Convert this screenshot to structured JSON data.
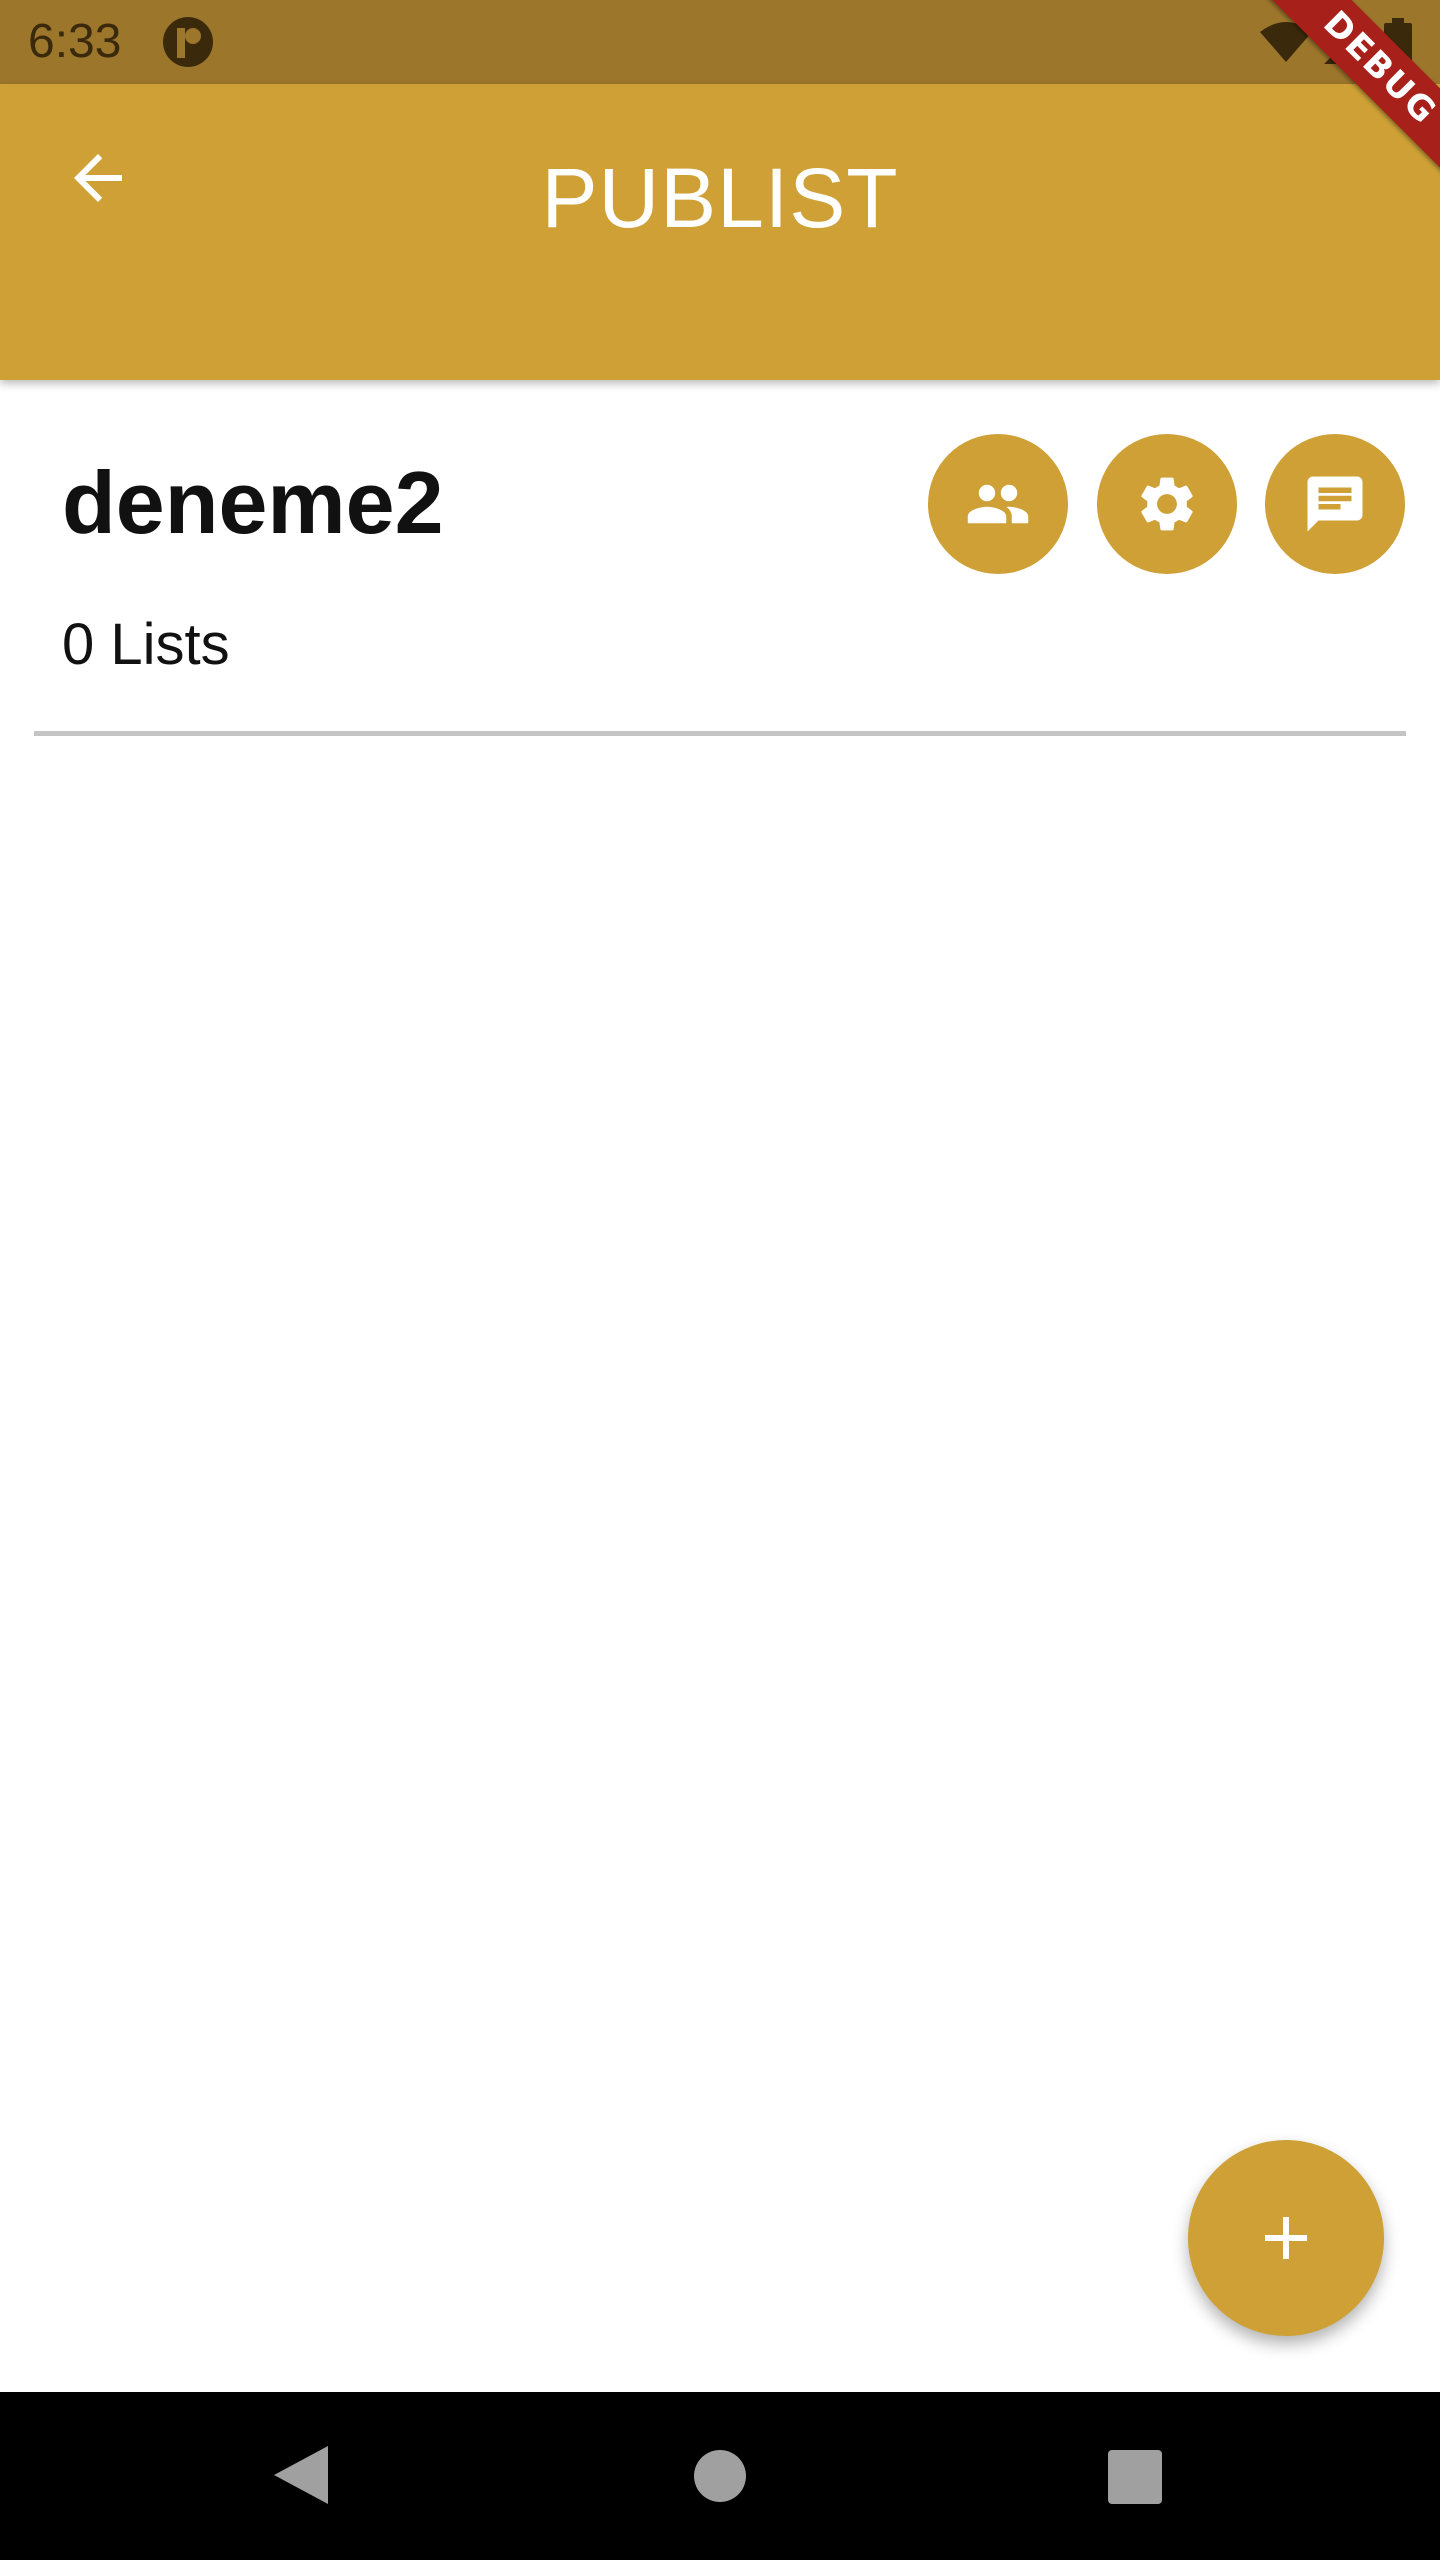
{
  "status_bar": {
    "time": "6:33",
    "icons": [
      "app-notification-icon",
      "wifi-icon",
      "signal-icon",
      "battery-icon"
    ]
  },
  "app_bar": {
    "title": "PUBLIST",
    "back_icon": "arrow-back-icon",
    "background_color": "#cea036"
  },
  "debug_banner": {
    "label": "DEBUG",
    "color": "#a8201a"
  },
  "group": {
    "name": "deneme2",
    "list_count_text": "0 Lists"
  },
  "actions": [
    {
      "name": "members",
      "icon": "people-icon"
    },
    {
      "name": "settings",
      "icon": "gear-icon"
    },
    {
      "name": "chat",
      "icon": "message-icon"
    }
  ],
  "fab": {
    "icon": "plus-icon"
  },
  "nav_bar": {
    "buttons": [
      "back-triangle-icon",
      "home-circle-icon",
      "recents-square-icon"
    ]
  },
  "colors": {
    "accent": "#cea036",
    "status_bar": "#9c762b",
    "divider": "#c4c4c4"
  }
}
